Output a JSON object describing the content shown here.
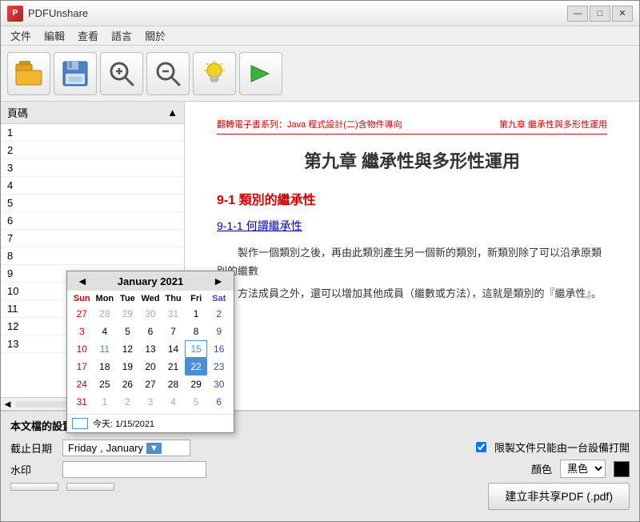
{
  "window": {
    "title": "PDFUnshare",
    "minimize": "—",
    "maximize": "□",
    "close": "✕"
  },
  "menu": {
    "items": [
      "文件",
      "編輯",
      "查看",
      "語言",
      "關於"
    ]
  },
  "toolbar": {
    "open_icon": "🟧",
    "save_icon": "💾",
    "zoom_in_icon": "🔍+",
    "zoom_out_icon": "🔍-",
    "idea_icon": "💡",
    "next_icon": "➡"
  },
  "sidebar": {
    "header": "頁碼",
    "pages": [
      "1",
      "2",
      "3",
      "4",
      "5",
      "6",
      "7",
      "8",
      "9",
      "10",
      "11",
      "12",
      "13"
    ]
  },
  "content": {
    "header_left": "翻轉電子書系列：Java 程式設計(二)含物件導向",
    "header_right": "第九章 繼承性與多形性運用",
    "title": "第九章  繼承性與多形性運用",
    "section1": "9-1 類別的繼承性",
    "subsection1": "9-1-1 何謂繼承性",
    "body1": "製作一個類別之後，再由此類別產生另一個新的類別，新類別除了可以沿承原類別的繼數",
    "body2": "方法成員之外，還可以增加其他成員（繼數或方法），這就是類別的『繼承性』。"
  },
  "bottom_panel": {
    "title": "本文檔的設置",
    "deadline_label": "截止日期",
    "date_day": "Friday",
    "date_comma": ",",
    "date_month": "January",
    "watermark_label": "水印",
    "restrict_checkbox": "限製文件只能由一台設備打開",
    "color_label": "顏色",
    "color_value": "黑色",
    "build_button": "建立非共享PDF (.pdf)"
  },
  "calendar": {
    "title": "January 2021",
    "prev": "◄",
    "next": "►",
    "days_header": [
      "Sun",
      "Mon",
      "Tue",
      "Wed",
      "Thu",
      "Fri",
      "Sat"
    ],
    "weeks": [
      [
        "27",
        "28",
        "29",
        "30",
        "31",
        "1",
        "2"
      ],
      [
        "3",
        "4",
        "5",
        "6",
        "7",
        "8",
        "9"
      ],
      [
        "10",
        "11",
        "12",
        "13",
        "14",
        "15",
        "16"
      ],
      [
        "17",
        "18",
        "19",
        "20",
        "21",
        "22",
        "23"
      ],
      [
        "24",
        "25",
        "26",
        "27",
        "28",
        "29",
        "30"
      ],
      [
        "31",
        "1",
        "2",
        "3",
        "4",
        "5",
        "6"
      ]
    ],
    "other_month_week0": [
      true,
      true,
      true,
      true,
      true,
      false,
      false
    ],
    "other_month_week5": [
      false,
      true,
      true,
      true,
      true,
      true,
      true
    ],
    "today_cell": {
      "week": 2,
      "day": 5
    },
    "selected_cell": {
      "week": 3,
      "day": 5
    },
    "today_label": "今天: 1/15/2021"
  }
}
